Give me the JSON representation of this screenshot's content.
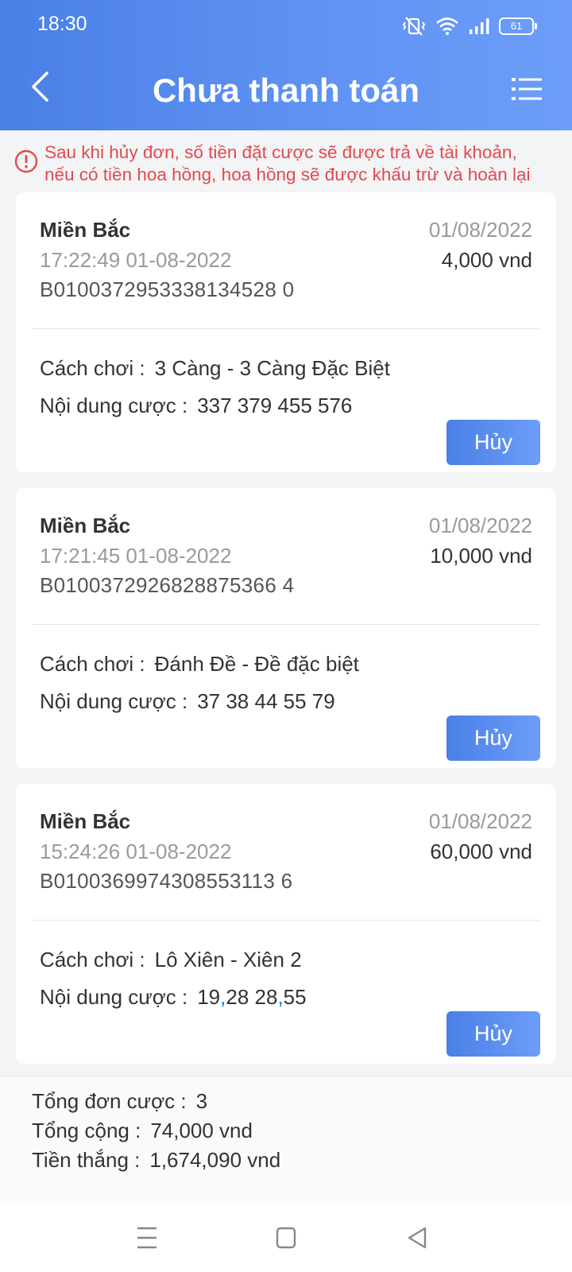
{
  "status_bar": {
    "time": "18:30",
    "battery": "61",
    "icons": [
      "vibrate-icon",
      "wifi-icon",
      "signal-icon",
      "battery-icon"
    ]
  },
  "header": {
    "title": "Chưa thanh toán",
    "back_icon": "back-arrow-icon",
    "menu_icon": "list-menu-icon"
  },
  "notice": {
    "line1": "Sau khi hủy đơn, số tiền đặt cược sẽ được trả về tài khoản,",
    "line2": "nếu có tiền hoa hồng, hoa hồng sẽ được khấu trừ và hoàn lại",
    "icon": "alert-circle-icon"
  },
  "labels": {
    "play_method": "Cách chơi :",
    "bet_content": "Nội dung cược :",
    "cancel": "Hủy"
  },
  "orders": [
    {
      "region": "Miền Bắc",
      "time": "17:22:49  01-08-2022",
      "code": "B0100372953338134528 0",
      "date": "01/08/2022",
      "amount": "4,000 vnd",
      "method": "3 Càng - 3 Càng Đặc Biệt",
      "content": "337 379 455 576"
    },
    {
      "region": "Miền Bắc",
      "time": "17:21:45  01-08-2022",
      "code": "B0100372926828875366 4",
      "date": "01/08/2022",
      "amount": "10,000 vnd",
      "method": "Đánh Đề - Đề đặc biệt",
      "content": "37 38 44 55 79"
    },
    {
      "region": "Miền Bắc",
      "time": "15:24:26  01-08-2022",
      "code": "B0100369974308553113 6",
      "date": "01/08/2022",
      "amount": "60,000 vnd",
      "method": "Lô Xiên - Xiên 2",
      "content_parts": [
        "19",
        ",",
        "28 28",
        ",",
        "55"
      ]
    }
  ],
  "summary": {
    "total_orders_label": "Tổng đơn cược :",
    "total_orders": "3",
    "total_label": "Tổng cộng :",
    "total": "74,000 vnd",
    "win_label": "Tiền thắng :",
    "win": "1,674,090 vnd"
  },
  "system_nav": [
    "recent-apps-icon",
    "home-icon",
    "back-icon"
  ]
}
